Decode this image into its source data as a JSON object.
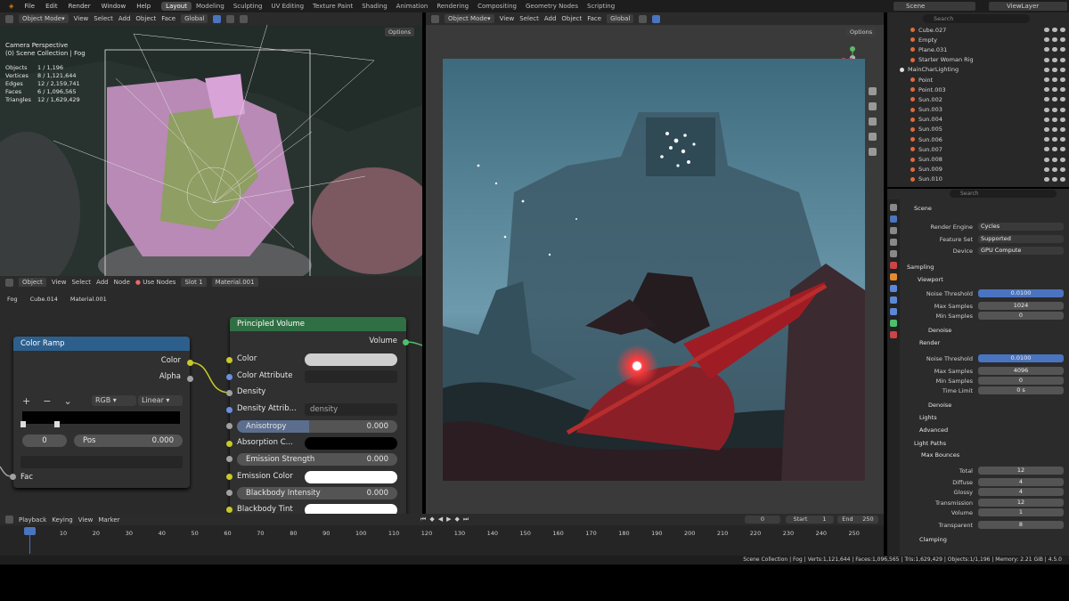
{
  "topbar": {
    "menus": [
      "File",
      "Edit",
      "Render",
      "Window",
      "Help"
    ],
    "workspaces": [
      "Layout",
      "Modeling",
      "Sculpting",
      "UV Editing",
      "Texture Paint",
      "Shading",
      "Animation",
      "Rendering",
      "Compositing",
      "Geometry Nodes",
      "Scripting"
    ],
    "active_workspace": "Layout",
    "scene": "Scene",
    "view_layer": "ViewLayer"
  },
  "viewport3d": {
    "mode": "Object Mode",
    "menus": [
      "View",
      "Select",
      "Add",
      "Object",
      "Face"
    ],
    "orientation": "Global",
    "options": "Options",
    "title": "Camera Perspective",
    "subtitle": "(0) Scene Collection | Fog",
    "stats": [
      {
        "k": "Objects",
        "v": "1 / 1,196"
      },
      {
        "k": "Vertices",
        "v": "8 / 1,121,644"
      },
      {
        "k": "Edges",
        "v": "12 / 2,159,741"
      },
      {
        "k": "Faces",
        "v": "6 / 1,096,565"
      },
      {
        "k": "Triangles",
        "v": "12 / 1,629,429"
      }
    ]
  },
  "render_viewport": {
    "mode": "Object Mode",
    "menus": [
      "View",
      "Select",
      "Add",
      "Object",
      "Face"
    ],
    "orientation": "Global",
    "options": "Options"
  },
  "node_editor": {
    "type": "Object",
    "menus": [
      "View",
      "Select",
      "Add",
      "Node"
    ],
    "use_nodes": "Use Nodes",
    "slot": "Slot 1",
    "material": "Material.001",
    "breadcrumb": [
      "Fog",
      "Cube.014",
      "Material.001"
    ],
    "color_ramp": {
      "title": "Color Ramp",
      "outputs": [
        "Color",
        "Alpha"
      ],
      "mode": "RGB",
      "interp": "Linear",
      "index": "0",
      "pos_label": "Pos",
      "pos_value": "0.000",
      "input": "Fac"
    },
    "principled": {
      "title": "Principled Volume",
      "output": "Volume",
      "rows": {
        "color": "Color",
        "color_attr": "Color Attribute",
        "density": "Density",
        "density_attr": "Density Attrib...",
        "density_attr_val": "density",
        "anisotropy": "Anisotropy",
        "anisotropy_val": "0.000",
        "absorption": "Absorption C...",
        "emission_strength": "Emission Strength",
        "emission_strength_val": "0.000",
        "emission_color": "Emission Color",
        "blackbody": "Blackbody Intensity",
        "blackbody_val": "0.000",
        "blackbody_tint": "Blackbody Tint"
      }
    }
  },
  "outliner": {
    "search_placeholder": "Search",
    "items": [
      {
        "name": "Cube.027",
        "indent": 1
      },
      {
        "name": "Empty",
        "indent": 1
      },
      {
        "name": "Plane.031",
        "indent": 1
      },
      {
        "name": "Starter Woman Rig",
        "indent": 1
      },
      {
        "name": "MainCharLighting",
        "indent": 0
      },
      {
        "name": "Point",
        "indent": 1
      },
      {
        "name": "Point.003",
        "indent": 1
      },
      {
        "name": "Sun.002",
        "indent": 1
      },
      {
        "name": "Sun.003",
        "indent": 1
      },
      {
        "name": "Sun.004",
        "indent": 1
      },
      {
        "name": "Sun.005",
        "indent": 1
      },
      {
        "name": "Sun.006",
        "indent": 1
      },
      {
        "name": "Sun.007",
        "indent": 1
      },
      {
        "name": "Sun.008",
        "indent": 1
      },
      {
        "name": "Sun.009",
        "indent": 1
      },
      {
        "name": "Sun.010",
        "indent": 1
      }
    ]
  },
  "properties": {
    "search_placeholder": "Search",
    "scene": "Scene",
    "render_engine_label": "Render Engine",
    "render_engine": "Cycles",
    "feature_set_label": "Feature Set",
    "feature_set": "Supported",
    "device_label": "Device",
    "device": "GPU Compute",
    "sampling": "Sampling",
    "viewport": "Viewport",
    "noise_threshold_label": "Noise Threshold",
    "vp_noise_threshold": "0.0100",
    "max_samples_label": "Max Samples",
    "vp_max_samples": "1024",
    "min_samples_label": "Min Samples",
    "vp_min_samples": "0",
    "denoise": "Denoise",
    "render": "Render",
    "r_noise_threshold": "0.0100",
    "r_max_samples": "4096",
    "r_min_samples": "0",
    "time_limit_label": "Time Limit",
    "time_limit": "0 s",
    "lights": "Lights",
    "advanced": "Advanced",
    "light_paths": "Light Paths",
    "max_bounces": "Max Bounces",
    "bounces": [
      {
        "k": "Total",
        "v": "12"
      },
      {
        "k": "Diffuse",
        "v": "4"
      },
      {
        "k": "Glossy",
        "v": "4"
      },
      {
        "k": "Transmission",
        "v": "12"
      },
      {
        "k": "Volume",
        "v": "1"
      },
      {
        "k": "Transparent",
        "v": "8"
      }
    ],
    "clamping": "Clamping"
  },
  "timeline": {
    "menus": [
      "Playback",
      "Keying",
      "View",
      "Marker"
    ],
    "current_frame": "0",
    "start_label": "Start",
    "start": "1",
    "end_label": "End",
    "end": "250",
    "ticks": [
      "0",
      "10",
      "20",
      "30",
      "40",
      "50",
      "60",
      "70",
      "80",
      "90",
      "100",
      "110",
      "120",
      "130",
      "140",
      "150",
      "160",
      "170",
      "180",
      "190",
      "200",
      "210",
      "220",
      "230",
      "240",
      "250"
    ]
  },
  "status": {
    "text": "Scene Collection | Fog | Verts:1,121,644 | Faces:1,096,565 | Tris:1,629,429 | Objects:1/1,196 | Memory: 2.21 GiB | 4.5.0"
  },
  "colors": {
    "node_green": "#2f6f43",
    "node_blue": "#2d5f8c",
    "accent_active": "#4a74bf",
    "socket_yellow": "#c8c82a",
    "socket_gray": "#a1a1a1",
    "socket_blue": "#6b8ee0",
    "socket_green": "#4cc26b"
  }
}
